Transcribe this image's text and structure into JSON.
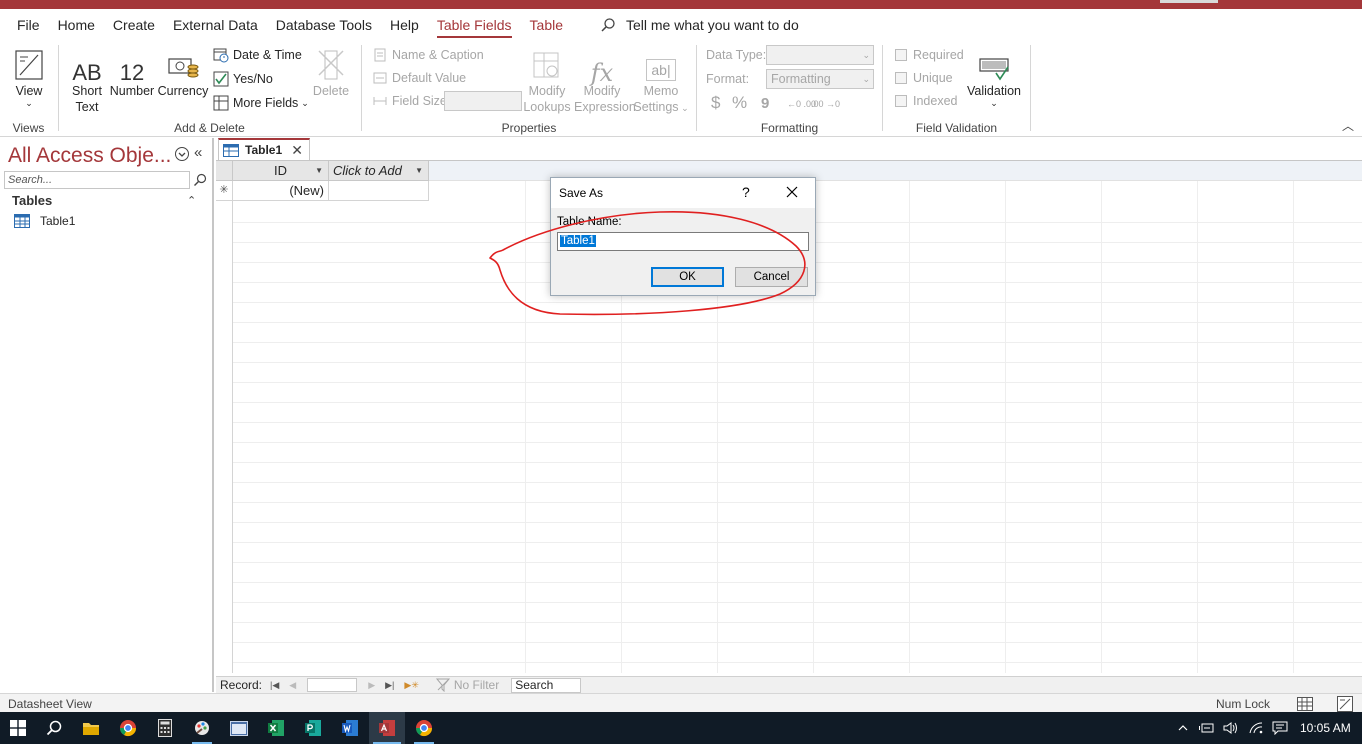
{
  "menubar": {
    "tabs": [
      "File",
      "Home",
      "Create",
      "External Data",
      "Database Tools",
      "Help",
      "Table Fields",
      "Table"
    ],
    "active_tab": "Table Fields",
    "tellme": "Tell me what you want to do"
  },
  "ribbon": {
    "views": {
      "view_label": "View",
      "group_label": "Views"
    },
    "add_delete": {
      "short_text_icon": "AB",
      "short_text_line1": "Short",
      "short_text_line2": "Text",
      "number_icon": "12",
      "number_label": "Number",
      "currency_label": "Currency",
      "date_time": "Date & Time",
      "yes_no": "Yes/No",
      "more_fields": "More Fields",
      "delete": "Delete",
      "group_label": "Add & Delete"
    },
    "properties": {
      "name_caption": "Name & Caption",
      "default_value": "Default Value",
      "field_size": "Field Size",
      "modify_lookups_1": "Modify",
      "modify_lookups_2": "Lookups",
      "modify_expression_1": "Modify",
      "modify_expression_2": "Expression",
      "memo_settings_1": "Memo",
      "memo_settings_2": "Settings",
      "fx_icon": "fx",
      "ab_icon": "ab|",
      "group_label": "Properties"
    },
    "formatting": {
      "data_type_label": "Data Type:",
      "format_label": "Format:",
      "format_value": "Formatting",
      "currency_symbol": "$",
      "percent_symbol": "%",
      "comma_symbol": "9",
      "inc_decimals": "←0 .00",
      "dec_decimals": ".00 →0",
      "group_label": "Formatting"
    },
    "field_validation": {
      "required": "Required",
      "unique": "Unique",
      "indexed": "Indexed",
      "validation": "Validation",
      "group_label": "Field Validation"
    }
  },
  "nav": {
    "title": "All Access Obje...",
    "search_placeholder": "Search...",
    "section": "Tables",
    "items": [
      "Table1"
    ]
  },
  "document": {
    "tab_label": "Table1",
    "columns": [
      "ID",
      "Click to Add"
    ],
    "new_row_marker": "✳",
    "new_row_value": "(New)"
  },
  "recordbar": {
    "record_label": "Record:",
    "no_filter": "No Filter",
    "search": "Search"
  },
  "statusbar": {
    "left": "Datasheet View",
    "numlock": "Num Lock"
  },
  "taskbar": {
    "time": "10:05 AM"
  },
  "dialog": {
    "title": "Save As",
    "help": "?",
    "label": "Table Name:",
    "value": "Table1",
    "ok": "OK",
    "cancel": "Cancel"
  },
  "colors": {
    "accent": "#a4373a",
    "annotation": "#e02020",
    "taskbar": "#101b26"
  }
}
